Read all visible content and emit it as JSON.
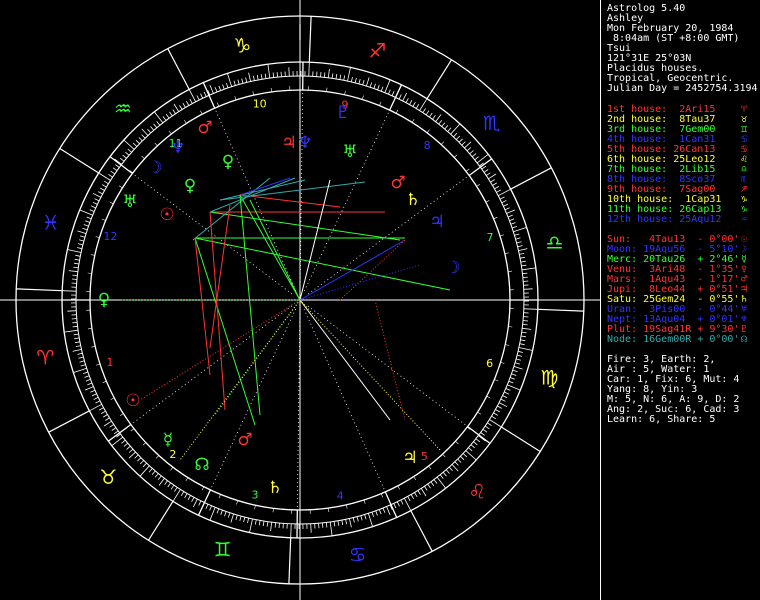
{
  "header": [
    "Astrolog 5.40",
    "Ashley",
    "Mon February 20, 1984",
    " 8:04am (ST +8:00 GMT)",
    "Tsui",
    "121°31E 25°03N",
    "Placidus houses.",
    "Tropical, Geocentric.",
    "Julian Day = 2452754.3194"
  ],
  "houses": [
    {
      "text": "1st house:  2Ari15",
      "glyph": "♈",
      "color": "#ff3333"
    },
    {
      "text": "2nd house:  8Tau37",
      "glyph": "♉",
      "color": "#ffff33"
    },
    {
      "text": "3rd house:  7Gem00",
      "glyph": "♊",
      "color": "#33ff33"
    },
    {
      "text": "4th house:  1Can31",
      "glyph": "♋",
      "color": "#3333ff"
    },
    {
      "text": "5th house: 26Can13",
      "glyph": "♋",
      "color": "#ff3333"
    },
    {
      "text": "6th house: 25Leo12",
      "glyph": "♌",
      "color": "#ffff33"
    },
    {
      "text": "7th house:  2Lib15",
      "glyph": "♎",
      "color": "#33ff33"
    },
    {
      "text": "8th house:  8Sco37",
      "glyph": "♏",
      "color": "#3333ff"
    },
    {
      "text": "9th house:  7Sag00",
      "glyph": "♐",
      "color": "#ff3333"
    },
    {
      "text": "10th house:  1Cap31",
      "glyph": "♑",
      "color": "#ffff33"
    },
    {
      "text": "11th house: 26Cap13",
      "glyph": "♑",
      "color": "#33ff33"
    },
    {
      "text": "12th house: 25Aqu12",
      "glyph": "♒",
      "color": "#3333ff"
    }
  ],
  "planets": [
    {
      "text": "Sun:   4Tau13  - 0°00'",
      "glyph": "☉",
      "color": "#ff3333"
    },
    {
      "text": "Moon: 19Aqu56  - 5°10'",
      "glyph": "☽",
      "color": "#3333ff"
    },
    {
      "text": "Merc: 20Tau26  + 2°46'",
      "glyph": "☿",
      "color": "#33ff33"
    },
    {
      "text": "Venu:  3Ari48  - 1°35'",
      "glyph": "♀",
      "color": "#ff3333"
    },
    {
      "text": "Mars:  1Aqu43  - 1°17'",
      "glyph": "♂",
      "color": "#ff3333"
    },
    {
      "text": "Jupi:  8Leo44  + 0°51'",
      "glyph": "♃",
      "color": "#ff3333"
    },
    {
      "text": "Satu: 25Gem24  - 0°55'",
      "glyph": "♄",
      "color": "#ffff33"
    },
    {
      "text": "Uran:  3Pis00  - 0°44'",
      "glyph": "♅",
      "color": "#3333ff"
    },
    {
      "text": "Nept: 13Aqu04  + 0°01'",
      "glyph": "♆",
      "color": "#3333ff"
    },
    {
      "text": "Plut: 19Sag41R + 9°30'",
      "glyph": "♇",
      "color": "#ff3333"
    },
    {
      "text": "Node: 16Gem00R + 0°00'",
      "glyph": "☊",
      "color": "#33aaaa"
    }
  ],
  "summary": [
    "Fire: 3, Earth: 2,",
    "Air : 5, Water: 1",
    "Car: 1, Fix: 6, Mut: 4",
    "Yang: 8, Yin: 3",
    "M: 5, N: 6, A: 9, D: 2",
    "Ang: 2, Suc: 6, Cad: 3",
    "Learn: 6, Share: 5"
  ],
  "wheel": {
    "signs": [
      {
        "glyph": "♑",
        "color": "#ffff33"
      },
      {
        "glyph": "♐",
        "color": "#ff3333"
      },
      {
        "glyph": "♏",
        "color": "#3333ff"
      },
      {
        "glyph": "♎",
        "color": "#33ff33"
      },
      {
        "glyph": "♍",
        "color": "#ffff33"
      },
      {
        "glyph": "♌",
        "color": "#ff3333"
      },
      {
        "glyph": "♋",
        "color": "#3333ff"
      },
      {
        "glyph": "♊",
        "color": "#33ff33"
      },
      {
        "glyph": "♉",
        "color": "#ffff33"
      },
      {
        "glyph": "♈",
        "color": "#ff3333"
      },
      {
        "glyph": "♓",
        "color": "#3333ff"
      },
      {
        "glyph": "♒",
        "color": "#33ff33"
      }
    ],
    "house_numbers": [
      {
        "n": "10",
        "color": "#ffff33"
      },
      {
        "n": "9",
        "color": "#ff3333"
      },
      {
        "n": "8",
        "color": "#3333ff"
      },
      {
        "n": "7",
        "color": "#33ff33"
      },
      {
        "n": "6",
        "color": "#ffff33"
      },
      {
        "n": "5",
        "color": "#ff3333"
      },
      {
        "n": "4",
        "color": "#3333ff"
      },
      {
        "n": "3",
        "color": "#33ff33"
      },
      {
        "n": "2",
        "color": "#ffff33"
      },
      {
        "n": "1",
        "color": "#ff3333"
      },
      {
        "n": "12",
        "color": "#3333ff"
      },
      {
        "n": "11",
        "color": "#33ff33"
      }
    ],
    "planet_glyphs": [
      {
        "glyph": "♂",
        "color": "#ff3333",
        "name": "mars-top"
      },
      {
        "glyph": "♃",
        "color": "#ff3333",
        "name": "jupiter-top"
      },
      {
        "glyph": "♆",
        "color": "#3333ff",
        "name": "neptune-top"
      },
      {
        "glyph": "♇",
        "color": "#3333ff",
        "name": "pluto-top"
      },
      {
        "glyph": "♆",
        "color": "#3333ff",
        "name": "neptune-left"
      },
      {
        "glyph": "♀",
        "color": "#33ff33",
        "name": "venus-left"
      },
      {
        "glyph": "☽",
        "color": "#3333ff",
        "name": "moon-left"
      },
      {
        "glyph": "♅",
        "color": "#33ff33",
        "name": "uranus-top"
      },
      {
        "glyph": "♀",
        "color": "#33ff33",
        "name": "venus-far-left"
      },
      {
        "glyph": "♅",
        "color": "#33ff33",
        "name": "uranus-left"
      },
      {
        "glyph": "☉",
        "color": "#ff3333",
        "name": "sun-left"
      },
      {
        "glyph": "♂",
        "color": "#ff3333",
        "name": "mars-right"
      },
      {
        "glyph": "♄",
        "color": "#ffff33",
        "name": "saturn-right"
      },
      {
        "glyph": "♃",
        "color": "#3333ff",
        "name": "jupiter-right"
      },
      {
        "glyph": "☽",
        "color": "#3333ff",
        "name": "moon-right"
      },
      {
        "glyph": "♀",
        "color": "#33ff33",
        "name": "venus-west"
      },
      {
        "glyph": "☉",
        "color": "#ff3333",
        "name": "sun-lower-left"
      },
      {
        "glyph": "☿",
        "color": "#33ff33",
        "name": "mercury-lower"
      },
      {
        "glyph": "♂",
        "color": "#ff3333",
        "name": "mars-lower"
      },
      {
        "glyph": "☊",
        "color": "#33ff33",
        "name": "node-lower"
      },
      {
        "glyph": "♄",
        "color": "#ffff33",
        "name": "saturn-lower"
      },
      {
        "glyph": "♃",
        "color": "#ffff33",
        "name": "jupiter-lower-right"
      }
    ]
  }
}
